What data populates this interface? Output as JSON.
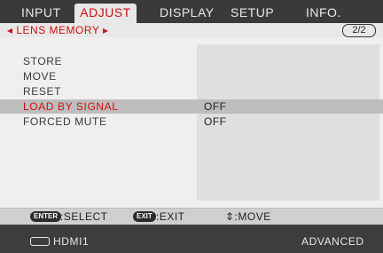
{
  "tabs": [
    {
      "label": "INPUT"
    },
    {
      "label": "ADJUST"
    },
    {
      "label": "DISPLAY"
    },
    {
      "label": "SETUP"
    },
    {
      "label": "INFO."
    }
  ],
  "submenu": {
    "title": "◂ LENS MEMORY ▸",
    "page": "2/2"
  },
  "menu": {
    "items": [
      {
        "label": "STORE"
      },
      {
        "label": "MOVE"
      },
      {
        "label": "RESET"
      },
      {
        "label": "LOAD BY SIGNAL",
        "value": "OFF"
      },
      {
        "label": "FORCED MUTE",
        "value": "OFF"
      }
    ]
  },
  "guide": {
    "enter_key": "ENTER",
    "enter_label": ":SELECT",
    "exit_key": "EXIT",
    "exit_label": ":EXIT",
    "move_label": "⇕:MOVE"
  },
  "status": {
    "source": "HDMI1",
    "mode": "ADVANCED"
  },
  "colors": {
    "accent": "#cc1111",
    "tab_active_bg": "#e8e8e8",
    "panel_bg": "#efefef",
    "highlight_bg": "#bdbdbd"
  }
}
